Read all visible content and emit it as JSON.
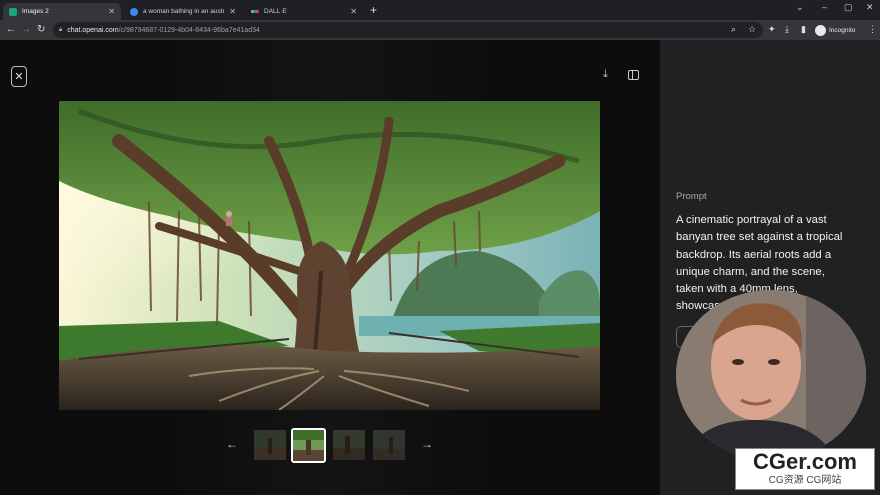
{
  "browser": {
    "tabs": [
      {
        "label": "Images 2",
        "fav_color": "#19a57f"
      },
      {
        "label": "a woman bathing in an austria…",
        "fav_color": "#4285f4"
      },
      {
        "label": "DALL·E",
        "fav_color": "#e5b429"
      }
    ],
    "url_domain": "chat.openai.com",
    "url_path": "/c/98794687-0129-4b04-8434-96ba7e41ad34",
    "incognito_label": "Incognito"
  },
  "viewer": {
    "close_icon": "close-icon",
    "download_icon": "download-icon",
    "sidebar_toggle_icon": "sidebar-toggle-icon"
  },
  "thumbnails": {
    "count": 4,
    "selected_index": 1
  },
  "prompt_panel": {
    "label": "Prompt",
    "text": "A cinematic portrayal of a vast banyan tree set against a tropical backdrop. Its aerial roots add a unique charm, and the scene, taken with a 40mm lens, showcases the lush gre"
  },
  "watermark": {
    "title": "CGer.com",
    "subtitle": "CG资源 CG网站"
  }
}
